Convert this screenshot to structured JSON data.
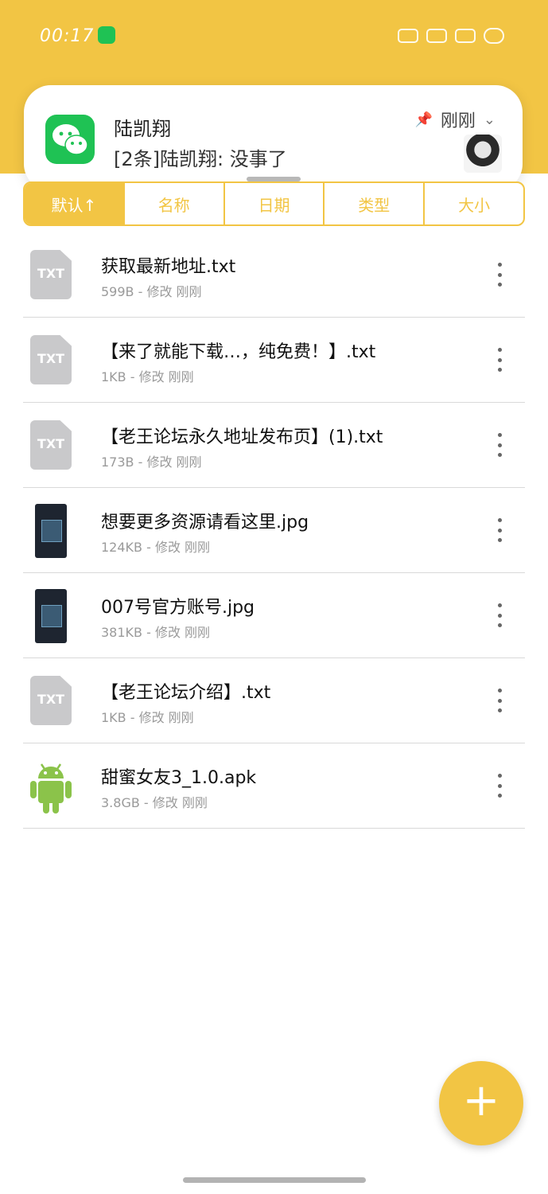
{
  "status_bar": {
    "time": "00:17"
  },
  "notification": {
    "sender": "陆凯翔",
    "message": "[2条]陆凯翔: 没事了",
    "time": "刚刚"
  },
  "sort_tabs": [
    {
      "label": "默认↑",
      "active": true
    },
    {
      "label": "名称",
      "active": false
    },
    {
      "label": "日期",
      "active": false
    },
    {
      "label": "类型",
      "active": false
    },
    {
      "label": "大小",
      "active": false
    }
  ],
  "files": [
    {
      "name": "获取最新地址.txt",
      "meta": "599B - 修改 刚刚",
      "icon": "txt-icon",
      "icon_label": "TXT"
    },
    {
      "name": "【来了就能下载…，纯免费！】.txt",
      "meta": "1KB - 修改 刚刚",
      "icon": "txt-icon",
      "icon_label": "TXT"
    },
    {
      "name": "【老王论坛永久地址发布页】(1).txt",
      "meta": "173B - 修改 刚刚",
      "icon": "txt-icon",
      "icon_label": "TXT"
    },
    {
      "name": "想要更多资源请看这里.jpg",
      "meta": "124KB - 修改 刚刚",
      "icon": "image-thumbnail",
      "icon_label": ""
    },
    {
      "name": "007号官方账号.jpg",
      "meta": "381KB - 修改 刚刚",
      "icon": "image-thumbnail",
      "icon_label": ""
    },
    {
      "name": "【老王论坛介绍】.txt",
      "meta": "1KB - 修改 刚刚",
      "icon": "txt-icon",
      "icon_label": "TXT"
    },
    {
      "name": "甜蜜女友3_1.0.apk",
      "meta": "3.8GB - 修改 刚刚",
      "icon": "android-icon",
      "icon_label": ""
    }
  ],
  "fab": {
    "label": "+"
  },
  "colors": {
    "accent": "#f2c544",
    "wechat_green": "#1fc254",
    "android_green": "#8bc34a"
  }
}
